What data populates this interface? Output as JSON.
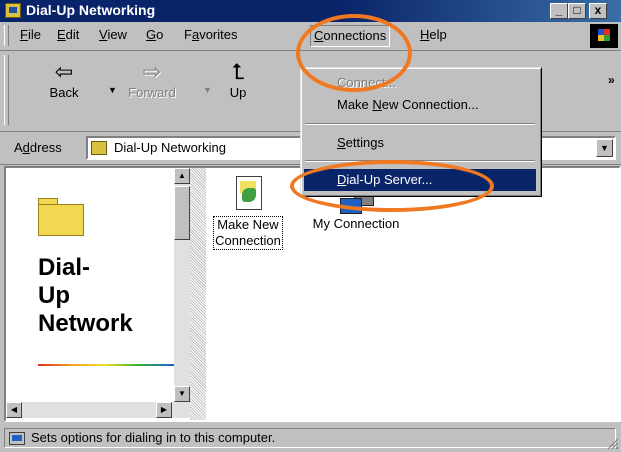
{
  "window": {
    "title": "Dial-Up Networking",
    "controls": {
      "minimize": "_",
      "maximize": "□",
      "close": "x"
    }
  },
  "menubar": {
    "items": [
      {
        "key": "file",
        "label": "File",
        "accel": "F",
        "rest": "ile"
      },
      {
        "key": "edit",
        "label": "Edit",
        "accel": "E",
        "rest": "dit"
      },
      {
        "key": "view",
        "label": "View",
        "accel": "V",
        "rest": "iew"
      },
      {
        "key": "go",
        "label": "Go",
        "accel": "G",
        "rest": "o"
      },
      {
        "key": "favorites",
        "label": "Favorites",
        "pre": "F",
        "accel": "a",
        "rest": "vorites"
      },
      {
        "key": "connections",
        "label": "Connections",
        "accel": "C",
        "rest": "onnections"
      },
      {
        "key": "help",
        "label": "Help",
        "accel": "H",
        "rest": "elp"
      }
    ]
  },
  "toolbar": {
    "back_label": "Back",
    "forward_label": "Forward",
    "up_label": "Up",
    "back_icon": "back-arrow-icon",
    "forward_icon": "forward-arrow-icon",
    "up_icon": "up-folder-icon",
    "more_label": "»"
  },
  "address": {
    "label_pre": "A",
    "label_accel": "d",
    "label_rest": "dress",
    "value": "Dial-Up Networking"
  },
  "left_pane": {
    "title_line1": "Dial-",
    "title_line2": "Up",
    "title_line3": "Network"
  },
  "files": [
    {
      "line1": "Make New",
      "line2": "Connection",
      "icon": "make-new-connection-icon"
    },
    {
      "label": "My Connection",
      "icon": "dialup-connection-icon"
    }
  ],
  "connections_menu": {
    "items": [
      {
        "label": "Connect...",
        "pre": "C",
        "accel": "o",
        "rest": "nnect...",
        "state": "disabled"
      },
      {
        "label": "Make New Connection...",
        "pre": "Make ",
        "accel": "N",
        "rest": "ew Connection...",
        "state": "normal"
      },
      {
        "label": "Settings",
        "pre": "",
        "accel": "S",
        "rest": "ettings",
        "state": "normal"
      },
      {
        "label": "Dial-Up Server...",
        "pre": "",
        "accel": "D",
        "rest": "ial-Up Server...",
        "state": "selected"
      }
    ]
  },
  "status": {
    "text": "Sets options for dialing in to this computer."
  },
  "colors": {
    "titlebar": "#0a246a",
    "highlight_annotation": "#f07820",
    "menu_selection": "#0a246a",
    "chrome": "#c0c0c0"
  }
}
